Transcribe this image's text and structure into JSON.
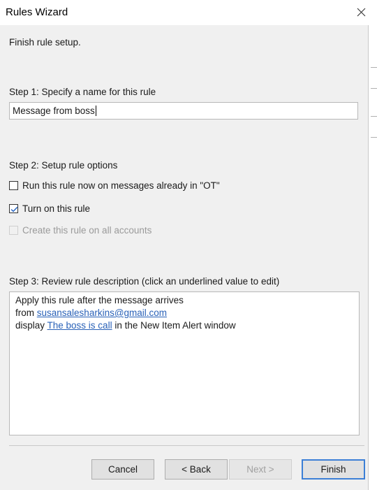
{
  "window": {
    "title": "Rules Wizard"
  },
  "header": {
    "instruction": "Finish rule setup."
  },
  "step1": {
    "label": "Step 1: Specify a name for this rule",
    "name_value": "Message from boss"
  },
  "step2": {
    "label": "Step 2: Setup rule options",
    "options": [
      {
        "label": "Run this rule now on messages already in \"OT\"",
        "checked": false,
        "enabled": true
      },
      {
        "label": "Turn on this rule",
        "checked": true,
        "enabled": true
      },
      {
        "label": "Create this rule on all accounts",
        "checked": false,
        "enabled": false
      }
    ]
  },
  "step3": {
    "label": "Step 3: Review rule description (click an underlined value to edit)",
    "line1": "Apply this rule after the message arrives",
    "line2_prefix": "from ",
    "line2_link": "susansalesharkins@gmail.com",
    "line3_prefix": "display ",
    "line3_link": "The boss is call",
    "line3_suffix": " in the New Item Alert window"
  },
  "buttons": {
    "cancel": "Cancel",
    "back": "< Back",
    "next": "Next >",
    "finish": "Finish"
  },
  "colors": {
    "link": "#2a62b8",
    "dialog_bg": "#f0f0f0",
    "default_button_border": "#3c7fd6"
  }
}
